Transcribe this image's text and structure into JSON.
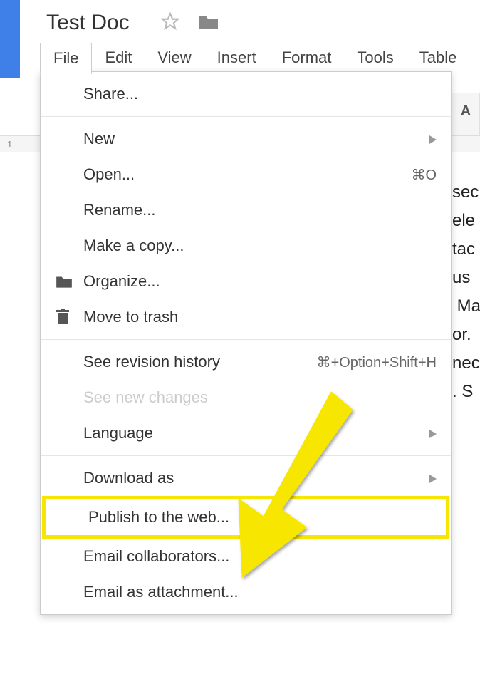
{
  "doc": {
    "title": "Test Doc"
  },
  "menubar": {
    "items": [
      "File",
      "Edit",
      "View",
      "Insert",
      "Format",
      "Tools",
      "Table"
    ]
  },
  "ruler": {
    "mark": "1"
  },
  "format_strip": {
    "label": "A"
  },
  "dropdown": {
    "share": "Share...",
    "new": "New",
    "open": "Open...",
    "open_shortcut": "⌘O",
    "rename": "Rename...",
    "make_copy": "Make a copy...",
    "organize": "Organize...",
    "move_to_trash": "Move to trash",
    "revision": "See revision history",
    "revision_shortcut": "⌘+Option+Shift+H",
    "new_changes": "See new changes",
    "language": "Language",
    "download": "Download as",
    "publish": "Publish to the web...",
    "email_collab": "Email collaborators...",
    "email_attach": "Email as attachment..."
  },
  "doc_body": {
    "fragments": [
      "sec",
      "ele",
      "tac",
      "us",
      " Ma",
      "or.",
      "nec",
      ". S"
    ]
  }
}
